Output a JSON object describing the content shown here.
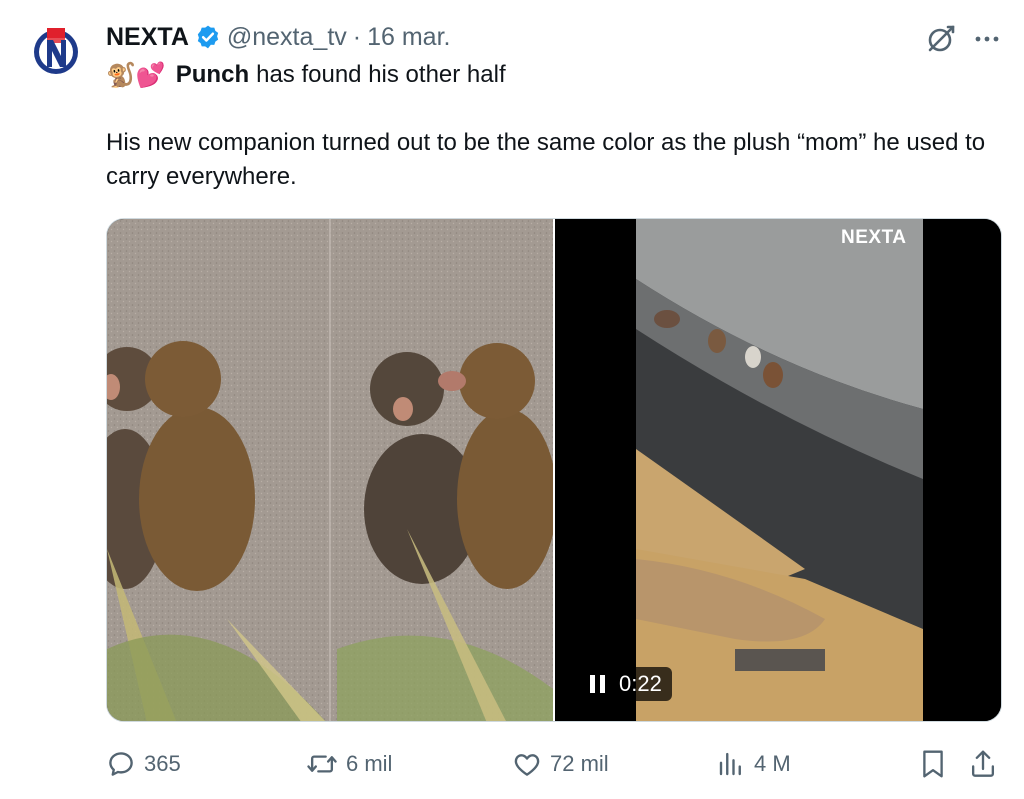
{
  "tweet": {
    "display_name": "NEXTA",
    "handle": "@nexta_tv",
    "separator": "·",
    "date": "16 mar.",
    "line1_emoji": "🐒💕",
    "line1_bold": "Punch",
    "line1_rest": "has found his other half",
    "body": "His new companion turned out to be the same color as the plush “mom” he used to carry everywhere."
  },
  "media": {
    "watermark": "NEXTA",
    "video_time": "0:22"
  },
  "actions": {
    "replies": "365",
    "retweets": "6 mil",
    "likes": "72 mil",
    "views": "4 M"
  },
  "colors": {
    "text": "#0f1419",
    "secondary": "#536471",
    "verified": "#1d9bf0",
    "brand_red": "#e0202c",
    "brand_blue": "#1e3a8a"
  },
  "icons": [
    "nexta-logo",
    "verified-badge-icon",
    "grok-icon",
    "more-icon",
    "pause-icon",
    "reply-icon",
    "retweet-icon",
    "like-icon",
    "views-icon",
    "bookmark-icon",
    "share-icon"
  ]
}
